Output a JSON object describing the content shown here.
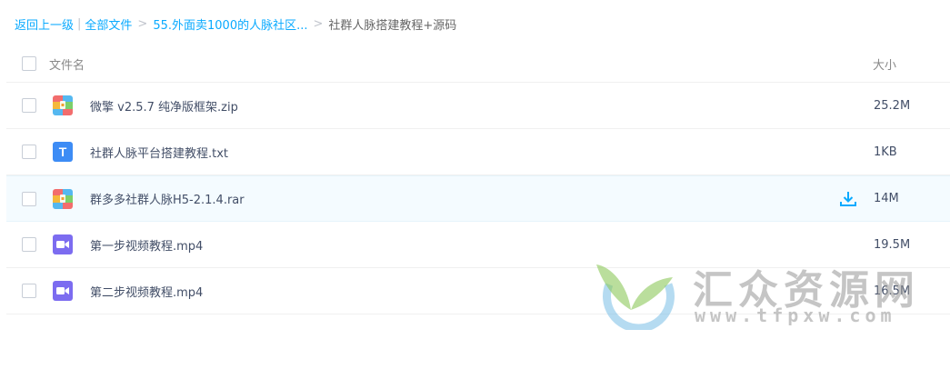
{
  "breadcrumb": {
    "back": "返回上一级",
    "all_files": "全部文件",
    "folder": "55.外面卖1000的人脉社区...",
    "current": "社群人脉搭建教程+源码",
    "separator": ">",
    "pipe": "|"
  },
  "header": {
    "name_col": "文件名",
    "size_col": "大小"
  },
  "files": [
    {
      "name": "微擎 v2.5.7 纯净版框架.zip",
      "size": "25.2M",
      "icon": "archive-icon"
    },
    {
      "name": "社群人脉平台搭建教程.txt",
      "size": "1KB",
      "icon": "text-file-icon"
    },
    {
      "name": "群多多社群人脉H5-2.1.4.rar",
      "size": "14M",
      "icon": "archive-icon"
    },
    {
      "name": "第一步视频教程.mp4",
      "size": "19.5M",
      "icon": "video-icon"
    },
    {
      "name": "第二步视频教程.mp4",
      "size": "16.5M",
      "icon": "video-icon"
    }
  ],
  "watermark": {
    "title": "汇众资源网",
    "url": "www.tfpxw.com"
  },
  "colors": {
    "link": "#09aaff",
    "hover_row": "#f4fbff",
    "txt_icon": "#3d8cf5",
    "video_icon": "#7c6cf0"
  }
}
